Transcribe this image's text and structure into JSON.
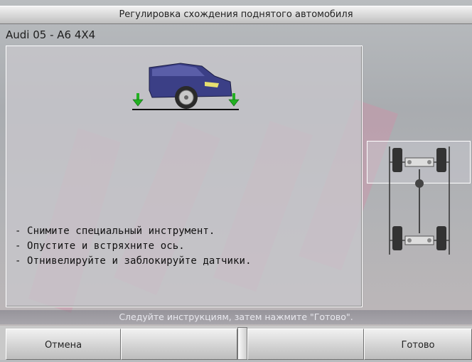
{
  "window": {
    "title": "Регулировка схождения поднятого автомобиля"
  },
  "vehicle": {
    "name": "Audi 05 - A6 4X4"
  },
  "instructions": [
    "- Снимите специальный инструмент.",
    "- Опустите и встряхните ось.",
    "- Отнивелируйте и заблокируйте датчики."
  ],
  "hint": "Следуйте инструкциям, затем нажмите \"Готово\".",
  "buttons": {
    "cancel": "Отмена",
    "blank1": "",
    "blank2": "",
    "done": "Готово"
  },
  "colors": {
    "car_body": "#3b3f86",
    "arrow": "#22b022",
    "panel_bg": "#c8c6cc"
  },
  "icons": [
    "lower-arrow-icon",
    "car-icon",
    "chassis-diagram-icon"
  ]
}
